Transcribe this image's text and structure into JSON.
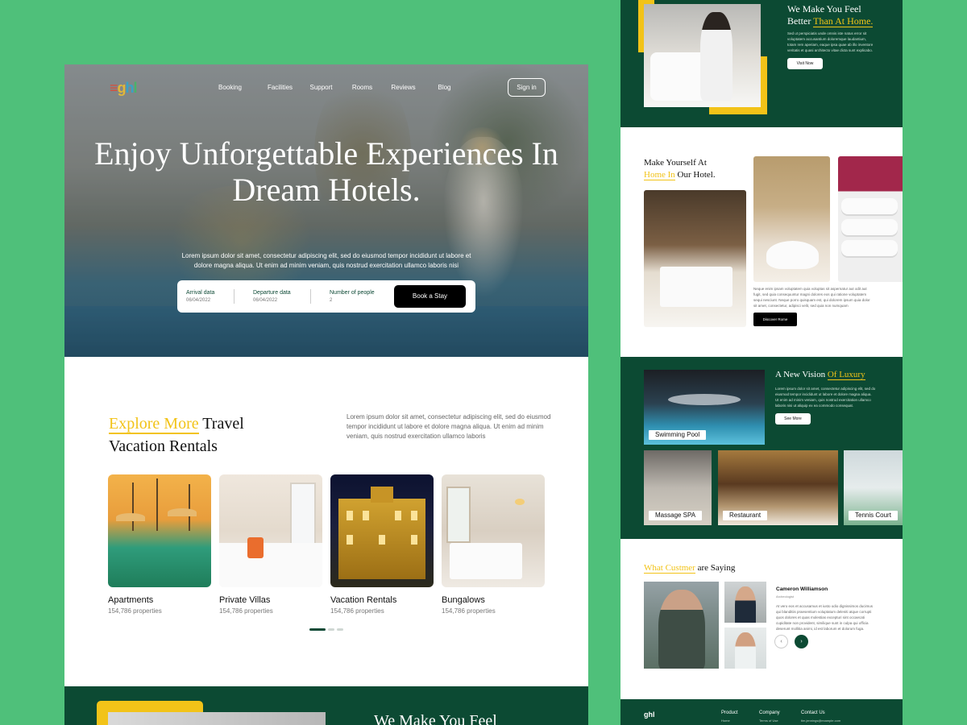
{
  "brand": {
    "logo_text": "ghl"
  },
  "nav": {
    "items": [
      "Booking",
      "Facilities",
      "Support",
      "Rooms",
      "Reviews",
      "Blog"
    ],
    "signin": "Sign in"
  },
  "hero": {
    "title": "Enjoy Unforgettable Experiences In Dream Hotels.",
    "subtitle": "Lorem ipsum dolor sit amet, consectetur adipiscing elit, sed do eiusmod tempor incididunt ut labore et dolore magna aliqua. Ut enim ad minim veniam, quis nostrud exercitation ullamco laboris nisi",
    "booking": {
      "arrival_label": "Arrival data",
      "arrival_value": "06/04/2022",
      "departure_label": "Departure data",
      "departure_value": "06/04/2022",
      "people_label": "Number of people",
      "people_value": "2",
      "button": "Book a Stay"
    }
  },
  "explore": {
    "title_highlight": "Explore More",
    "title_rest": " Travel",
    "title_line2": "Vacation Rentals",
    "description": "Lorem ipsum dolor sit amet, consectetur adipiscing elit, sed do eiusmod tempor incididunt ut labore et dolore magna aliqua. Ut enim ad minim veniam, quis nostrud exercitation ullamco laboris",
    "cards": [
      {
        "name": "Apartments",
        "properties": "154,786 properties"
      },
      {
        "name": "Private Villas",
        "properties": "154,786 properties"
      },
      {
        "name": "Vacation Rentals",
        "properties": "154,786 properties"
      },
      {
        "name": "Bungalows",
        "properties": "154,786 properties"
      }
    ]
  },
  "left_bottom": {
    "title": "We Make You Feel"
  },
  "feel_home": {
    "title_line1": "We Make You Feel",
    "title_pre": "Better ",
    "title_highlight": "Than At Home.",
    "description": "Sed ut perspiciatis unde omnis iste natus error sit voluptatem accusantium doloremque laudantium, totam rem aperiam, eaque ipsa quae ab illo inventore veritatis et quasi architecto vitae dicta sunt explicabo.",
    "button": "Visit Now"
  },
  "make_home": {
    "title_line1": "Make Yourself At",
    "title_highlight": "Home In",
    "title_rest": " Our Hotel.",
    "description": "Neque enim ipsam voluptatem quia voluptas sit aspernatur aut odit aut fugit, sed quia consequuntur magni dolores eos qui ratione voluptatem sequi nesciunt. Neque porro quisquam est, qui dolorem ipsum quia dolor sit amet, consectetur, adipisci velit, sed quia non numquam",
    "button": "Discover Rome"
  },
  "luxury": {
    "title_pre": "A New Vision ",
    "title_highlight": "Of Luxury",
    "description": "Lorem ipsum dolor sit amet, consectetur adipiscing elit, sed do eiusmod tempor incididunt ut labore et dolore magna aliqua. Ut enim ad minim veniam, quis nostrud exercitation ullamco laboris nisi ut aliquip ex ea commodo consequat.",
    "button": "See More",
    "tiles": [
      "Swimming Pool",
      "Massage SPA",
      "Restaurant",
      "Tennis Court"
    ]
  },
  "testimonial": {
    "title_highlight": "What Custmer",
    "title_rest": " are Saying",
    "name": "Cameron Williamson",
    "role": "Archeologist",
    "quote": "At vero eos et accusamus et iusto odio dignissimos ducimus qui blanditiis praesentium voluptatum deleniti atque corrupti quos dolores et quas molestias excepturi sint occaecati cupiditate non provident, similique sunt in culpa qui officia deserunt mollitia animi, id est laborum et dolorum fuga.",
    "prev": "‹",
    "next": "›"
  },
  "footer": {
    "logo": "ghl",
    "cols": [
      {
        "title": "Product",
        "item": "Home"
      },
      {
        "title": "Company",
        "item": "Terms of Use"
      },
      {
        "title": "Contact Us",
        "item": "tim.jennings@example.com"
      }
    ]
  },
  "colors": {
    "green": "#0c4a33",
    "yellow": "#f2c318",
    "background": "#4fc07a"
  }
}
